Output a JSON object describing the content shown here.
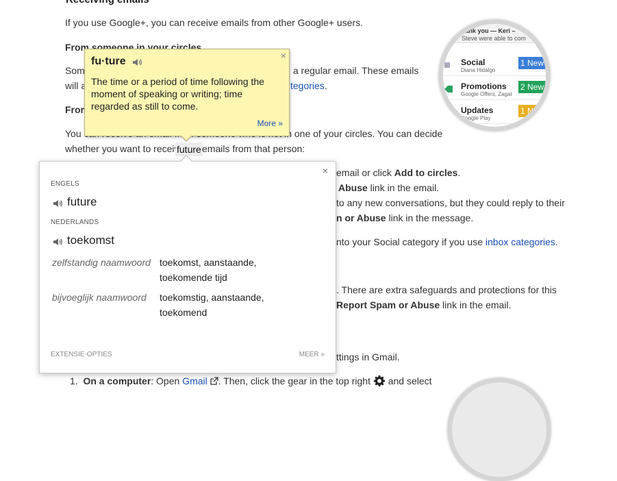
{
  "article": {
    "heading": "Receiving emails",
    "intro": "If you use Google+, you can receive emails from other Google+ users.",
    "section1_title": "From someone in your circles",
    "s1_line1_a": "Some",
    "s1_line1_b": "a regular email. These emails",
    "s1_line2_a": "will a",
    "s1_line2_link": "tegories",
    "s1_line2_end": ".",
    "section2_title_fragment": "From",
    "s2_para1_a": "You can receive an email from someone who is not in one of your circles. You can decide",
    "s2_para2_a": "whether you want to receive",
    "s2_para2_word": "future",
    "s2_para2_b": "emails from that person:",
    "right_lines": [
      {
        "pre": "email or click ",
        "bold": "Add to circles",
        "post": "."
      },
      {
        "pre": "",
        "bold": "Abuse",
        "post": " link in the email."
      },
      {
        "pre": "to any new conversations, but they could reply to their",
        "bold": "",
        "post": ""
      },
      {
        "pre": "",
        "bold": "n or Abuse",
        "post": " link in the message."
      }
    ],
    "social_line_pre": "nto your Social category if you use ",
    "social_line_link": "inbox categories",
    "social_line_post": ".",
    "safeguards_line": ". There are extra safeguards and protections for this",
    "report_bold": "Report Spam or Abuse",
    "report_post": " link in the email.",
    "settings_line": "ttings in Gmail.",
    "step1_num": "1.",
    "step1_bold": "On a computer",
    "step1_a": ": Open ",
    "step1_link": "Gmail",
    "step1_b": ". Then, click the gear in the top right",
    "step1_c": "and select"
  },
  "inbox_graphic": {
    "top_a": "hank you — Keri –",
    "top_b": "Steve were able to com",
    "rows": [
      {
        "label": "Social",
        "sub": "Diana Hidalgo",
        "badge": "1 New",
        "color": "#3a7ed8"
      },
      {
        "label": "Promotions",
        "sub": "Google Offers, Zagat",
        "badge": "2 New",
        "color": "#22a35a"
      },
      {
        "label": "Updates",
        "sub": "Google Play",
        "badge": "1 N",
        "color": "#e8b021"
      }
    ]
  },
  "dictionary_bubble": {
    "word": "fu·ture",
    "definition": "The time or a period of time following the moment of speaking or writing; time regarded as still to come.",
    "more_link": "More »",
    "close": "×"
  },
  "translation_popup": {
    "close": "×",
    "source_lang": "ENGELS",
    "source_term": "future",
    "target_lang": "NEDERLANDS",
    "target_term": "toekomst",
    "entries": [
      {
        "pos": "zelfstandig naamwoord",
        "translation": "toekomst, aanstaande, toekomende tijd"
      },
      {
        "pos": "bijvoeglijk naamwoord",
        "translation": "toekomstig, aanstaande, toekomend"
      }
    ],
    "footer_left": "EXTENSIE-OPTIES",
    "footer_right": "MEER »"
  },
  "colors": {
    "link": "#1a4fb4",
    "bubble_bg": "#fdf7b2",
    "text": "#333333"
  }
}
